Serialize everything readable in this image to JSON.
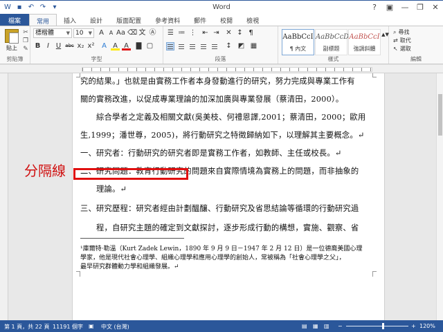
{
  "window": {
    "title": "Word",
    "controls": [
      "?",
      "▣",
      "—",
      "❐",
      "✕"
    ]
  },
  "tabs": [
    {
      "label": "檔案"
    },
    {
      "label": "常用"
    },
    {
      "label": "插入"
    },
    {
      "label": "設計"
    },
    {
      "label": "版面配置"
    },
    {
      "label": "參考資料"
    },
    {
      "label": "郵件"
    },
    {
      "label": "校閱"
    },
    {
      "label": "檢視"
    }
  ],
  "ribbon": {
    "clipboard": {
      "paste_label": "貼上",
      "group_label": "剪貼簿"
    },
    "font": {
      "font_name": "標楷體",
      "font_size": "10",
      "group_label": "字型",
      "buttons": [
        "B",
        "I",
        "U",
        "abc",
        "x₂",
        "x²",
        "A",
        "A",
        "A"
      ]
    },
    "paragraph": {
      "group_label": "段落"
    },
    "styles": {
      "group_label": "樣式",
      "items": [
        {
          "sample": "AaBbCcI",
          "name": "¶ 內文"
        },
        {
          "sample": "AaBbCcD",
          "name": "副標題"
        },
        {
          "sample": "AaBbCcI",
          "name": "強調斜體"
        }
      ]
    },
    "editing": {
      "group_label": "編輯",
      "find": "尋找",
      "replace": "取代",
      "select": "選取"
    }
  },
  "document": {
    "lines": [
      "究的結果。」也就是由實務工作者本身發動進行的研究，努力完成與專業工作有",
      "關的實務改進，以促成專業理論的加深加廣與專業發展（蔡清田，2000）。",
      "　　綜合學者之定義及相關文獻(吳美枝、何禮恩譯,2001；蔡清田，2000；歐用",
      "生,1999；潘世尊，2005)，將行動研究之特徵歸納如下，以理解其主要概念。↵",
      "一、研究者：行動研究的研究者即是實務工作者，如教師、主任或校長。↵",
      "二、研究問題：教育行動研究的問題來自實際情境為實務上的問題，而非抽象的",
      "　　理論。↵",
      "三、研究歷程：研究者經由計劃醞釀、行動研究及省思結論等循環的行動研究過",
      "　　程，自研究主題的確定到文獻探討，逐步形成行動的構想，實施、觀察、省"
    ],
    "footnote": [
      "¹庫爾特·勒溫（Kurt Zadek Lewin，1890 年 9 月 9 日－1947 年 2 月 12 日）是一位德裔美國心理",
      "學家，他是現代社會心理學、組織心理學和應用心理學的創始人，常被稱為「社會心理學之父」，",
      "最早研究群體動力學和組織發展。↵"
    ]
  },
  "annotation": {
    "label": "分隔線",
    "color": "#e01010"
  },
  "status": {
    "page": "第 1 頁，共 22 頁",
    "words": "11191 個字",
    "language": "中文 (台灣)",
    "zoom": "120%"
  },
  "colors": {
    "accent": "#2b579a",
    "annotation": "#e01010"
  }
}
